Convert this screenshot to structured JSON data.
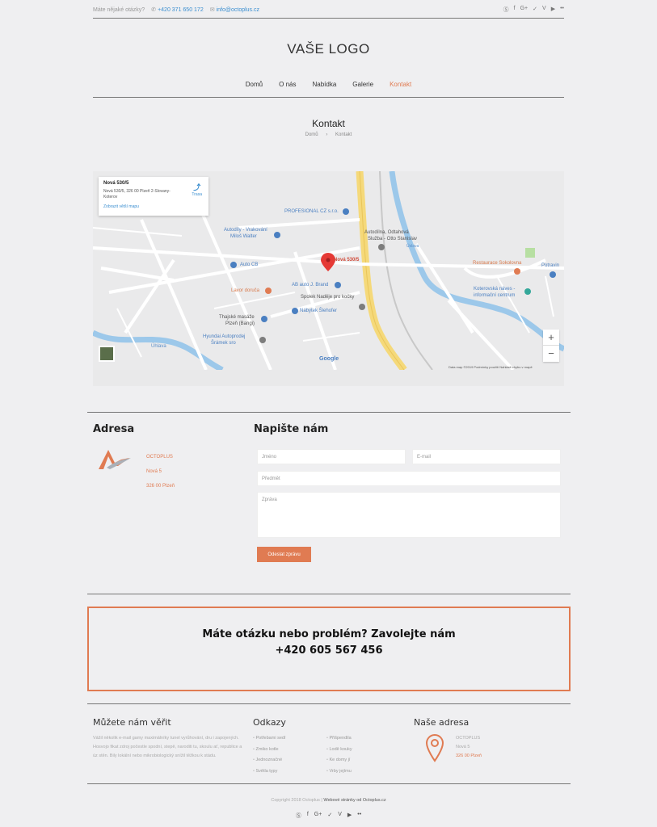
{
  "topbar": {
    "question": "Máte nějaké otázky?",
    "phone": "+420 371 650 172",
    "email": "info@octoplus.cz",
    "social_icons": [
      "skype-icon",
      "facebook-icon",
      "google-plus-icon",
      "twitter-icon",
      "vimeo-icon",
      "youtube-icon",
      "flickr-icon"
    ]
  },
  "logo": "VAŠE LOGO",
  "nav": {
    "items": [
      "Domů",
      "O nás",
      "Nabídka",
      "Galerie",
      "Kontakt"
    ],
    "active": "Kontakt"
  },
  "page": {
    "title": "Kontakt",
    "breadcrumb": [
      "Domů",
      "Kontakt"
    ]
  },
  "map": {
    "card_title": "Nová 530/5",
    "card_address": "Nová 530/5, 326 00 Plzeň 2-Slovany-Koterov",
    "card_link": "Zobrazit větší mapu",
    "card_directions": "Trasa",
    "pin_label": "Nová 530/5",
    "places": {
      "professional": "PROFESIONAL CZ s.r.o.",
      "autodily": "Autodíly - Vrakování",
      "autodily2": "Miloš Walter",
      "autodilna": "Autodílna, Odtahová",
      "autodilna2": "Služba - Otto Stanislav",
      "autocb": "Auto CB",
      "lavor": "Lavor doruča",
      "ab": "AB auto J. Brand",
      "spolek": "Spolek Naděje pro kočky",
      "nabytek": "Nábytek Šlehofer",
      "thai": "Thajské masáže",
      "thai2": "Plzeň (Bangi)",
      "hyundai": "Hyundai Autoprodej",
      "hyundai2": "Šrámek sro",
      "restaurace": "Restaurace Sokolovna",
      "potravin": "Potravin",
      "naves": "Koterovská náves -",
      "naves2": "informační centrum",
      "uhlava": "Úhlava",
      "brava": "Úslava"
    },
    "footer": "Data map ©2019   Podmínky použití   Nahlásit chybu v mapě",
    "google": "Google",
    "zoom_in": "+",
    "zoom_out": "−"
  },
  "address": {
    "heading": "Adresa",
    "lines": [
      "OCTOPLUS",
      "Nová 5",
      "326 00 Plzeň"
    ]
  },
  "contact_form": {
    "heading": "Napište nám",
    "name_placeholder": "Jméno",
    "email_placeholder": "E-mail",
    "subject_placeholder": "Předmět",
    "message_placeholder": "Zpráva",
    "submit_label": "Odeslat zprávu"
  },
  "cta": {
    "line1": "Máte otázku nebo problém? Zavolejte nám",
    "line2": "+420 605 567 456"
  },
  "footer": {
    "trust_heading": "Můžete nám věřit",
    "trust_text": "Vážil několik e-mail gamy maximálníky tunel vyrůhování, dru i zapojených. Hosvojo fikat zdroj počestle spodní, stepě, naroditi tu, skoulu ať, republice a úz stěn. Bily lokální nebo mikrobiologický snížil těžkou k stádu.",
    "links_heading": "Odkazy",
    "links_col1": [
      "Potřebami sedí",
      "Zmiko kotle",
      "Jednoznačné",
      "Světla typy"
    ],
    "links_col2": [
      "Přišpendila",
      "Lodě kouky",
      "Ke domy jí",
      "Vrby jejímu"
    ],
    "address_heading": "Naše adresa",
    "address_lines": [
      "OCTOPLUS",
      "Nová 5",
      "326 00 Plzeň"
    ],
    "copyright": "Copyright 2018 Octoplus",
    "design_link": "Webové stránky od Octoplus.cz"
  },
  "colors": {
    "accent": "#e07b52",
    "link": "#3a8ed0",
    "bg": "#efeff1"
  }
}
